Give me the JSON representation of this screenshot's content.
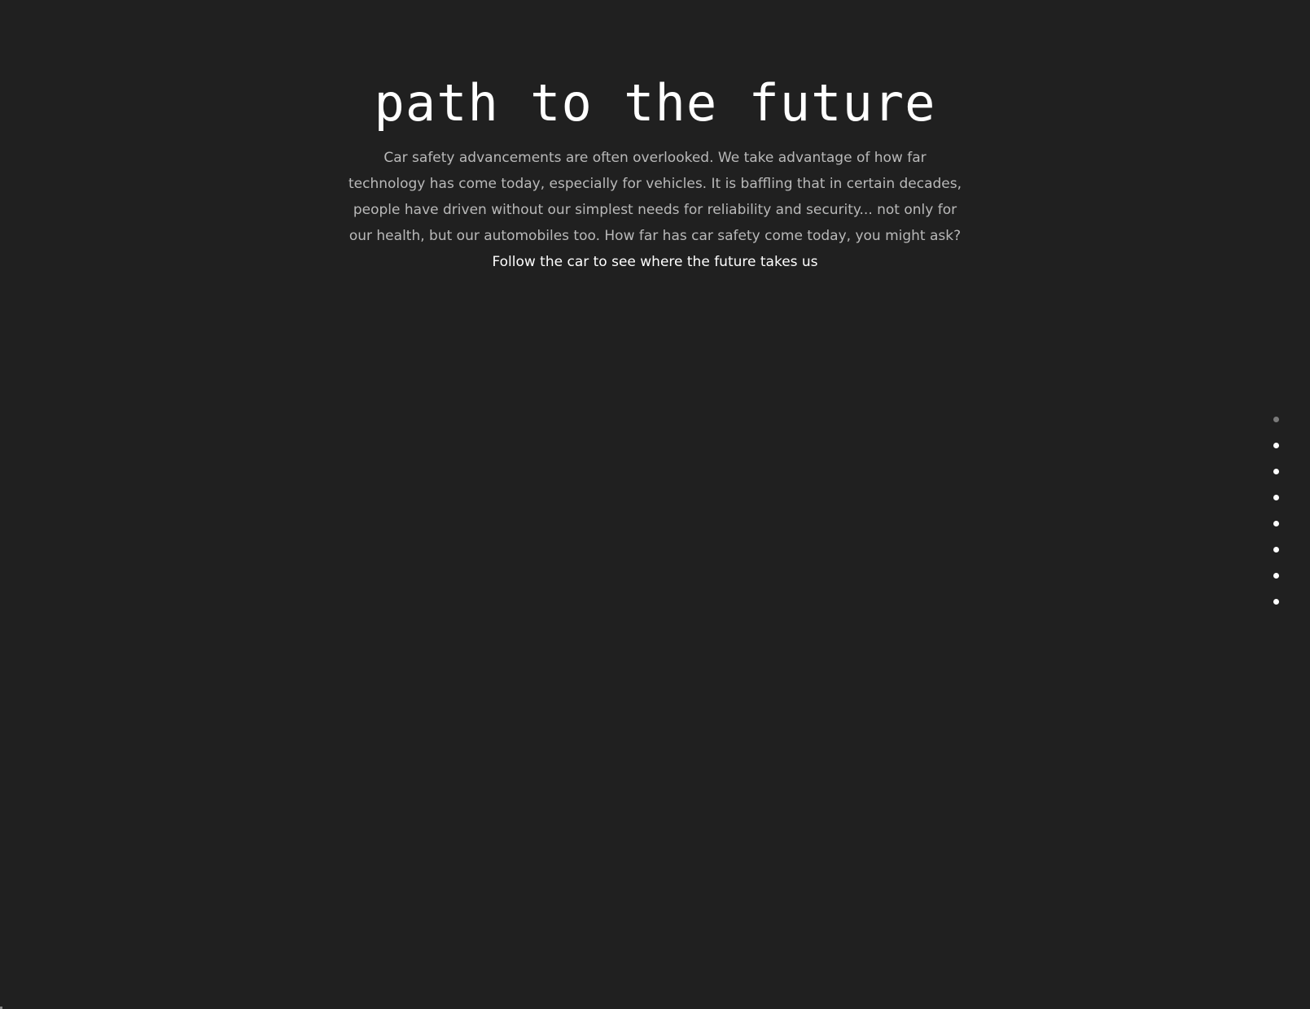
{
  "hero": {
    "title": "path to the future",
    "body": "Car safety advancements are often overlooked. We take advantage of how far technology has come today, especially for vehicles. It is baffling that in certain decades, people have driven without our simplest needs for reliability and security... not only for our health, but our automobiles too. How far has car safety come today, you might ask?",
    "cta": "Follow the car to see where the future takes us"
  },
  "dot_nav": {
    "count": 8,
    "active_index": 0
  },
  "colors": {
    "background": "#202020",
    "title": "#ffffff",
    "body_text": "#b9b9b9",
    "cta_text": "#ffffff",
    "dot": "#ffffff",
    "dot_active": "#7a7a7a"
  }
}
